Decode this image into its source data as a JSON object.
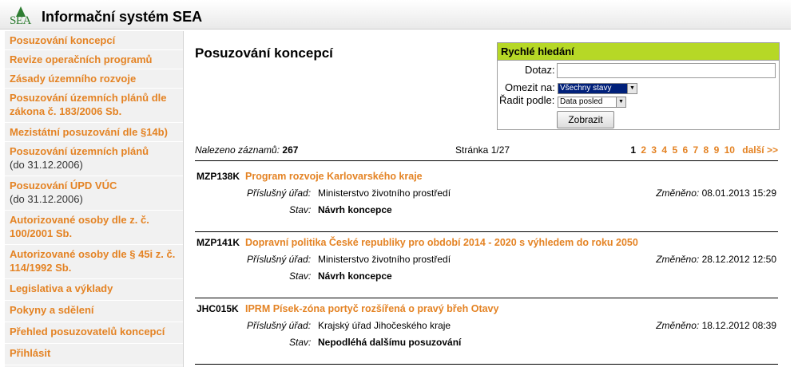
{
  "app": {
    "logo_text": "SEA",
    "title": "Informační systém SEA"
  },
  "sidebar": {
    "items": [
      {
        "label": "Posuzování koncepcí",
        "sub": ""
      },
      {
        "label": "Revize operačních programů",
        "sub": ""
      },
      {
        "label": "Zásady územního rozvoje",
        "sub": ""
      },
      {
        "label": "Posuzování územních plánů dle zákona č. 183/2006 Sb.",
        "sub": ""
      },
      {
        "label": "Mezistátní posuzování dle §14b)",
        "sub": ""
      },
      {
        "label": "Posuzování územních plánů",
        "sub": "(do 31.12.2006)"
      },
      {
        "label": "Posuzování ÚPD VÚC",
        "sub": "(do 31.12.2006)"
      },
      {
        "label": "Autorizované osoby dle z. č. 100/2001 Sb.",
        "sub": ""
      },
      {
        "label": "Autorizované osoby dle § 45i z. č. 114/1992 Sb.",
        "sub": ""
      },
      {
        "label": "Legislativa a výklady",
        "sub": ""
      },
      {
        "label": "Pokyny a sdělení",
        "sub": ""
      },
      {
        "label": "Přehled posuzovatelů koncepcí",
        "sub": ""
      },
      {
        "label": "Přihlásit",
        "sub": ""
      }
    ]
  },
  "main": {
    "title": "Posuzování koncepcí"
  },
  "quick_search": {
    "title": "Rychlé hledání",
    "query_label": "Dotaz:",
    "query_value": "",
    "limit_label": "Omezit na:",
    "limit_value": "Všechny stavy",
    "sort_label": "Řadit podle:",
    "sort_value": "Data posled",
    "submit_label": "Zobrazit"
  },
  "results": {
    "found_label": "Nalezeno záznamů:",
    "found_count": "267",
    "page_info": "Stránka 1/27",
    "pages": [
      "1",
      "2",
      "3",
      "4",
      "5",
      "6",
      "7",
      "8",
      "9",
      "10"
    ],
    "next_label": "další >>",
    "current_page": "1"
  },
  "records": [
    {
      "code": "MZP138K",
      "title": "Program rozvoje Karlovarského kraje",
      "office_label": "Příslušný úřad:",
      "office": "Ministerstvo životního prostředí",
      "status_label": "Stav:",
      "status": "Návrh koncepce",
      "changed_label": "Změněno:",
      "changed": "08.01.2013 15:29"
    },
    {
      "code": "MZP141K",
      "title": "Dopravní politika České republiky pro období 2014 - 2020 s výhledem do roku 2050",
      "office_label": "Příslušný úřad:",
      "office": "Ministerstvo životního prostředí",
      "status_label": "Stav:",
      "status": "Návrh koncepce",
      "changed_label": "Změněno:",
      "changed": "28.12.2012 12:50"
    },
    {
      "code": "JHC015K",
      "title": "IPRM Písek-zóna portyč rozšířená o pravý břeh Otavy",
      "office_label": "Příslušný úřad:",
      "office": "Krajský úřad Jihočeského kraje",
      "status_label": "Stav:",
      "status": "Nepodléhá dalšímu posuzování",
      "changed_label": "Změněno:",
      "changed": "18.12.2012 08:39"
    }
  ],
  "colors": {
    "accent": "#e48324",
    "search_header": "#b6d826",
    "logo": "#2e7d32"
  }
}
